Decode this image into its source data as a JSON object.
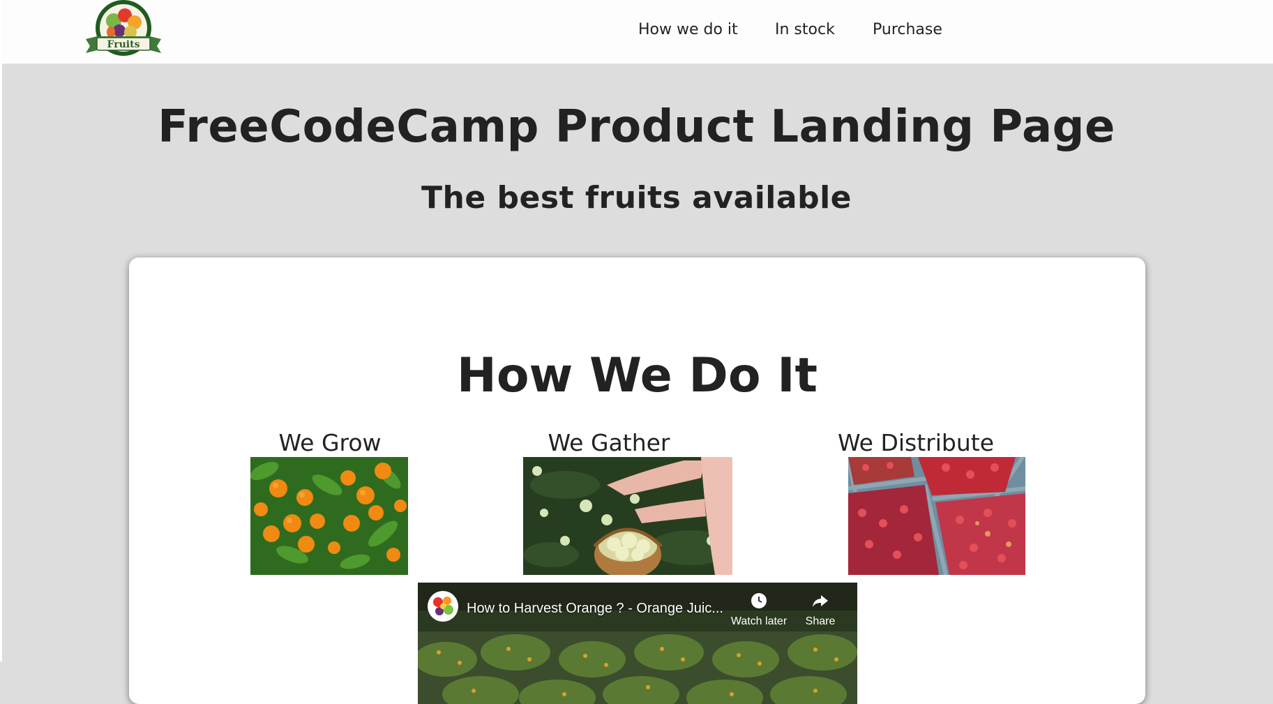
{
  "header": {
    "logo_text": "Fruits",
    "nav": [
      "How we do it",
      "In stock",
      "Purchase"
    ]
  },
  "hero": {
    "title": "FreeCodeCamp Product Landing Page",
    "subtitle": "The best fruits available"
  },
  "how": {
    "title": "How We Do It",
    "columns": [
      {
        "title": "We Grow",
        "image": "orange-tree-photo"
      },
      {
        "title": "We Gather",
        "image": "apple-gathering-photo"
      },
      {
        "title": "We Distribute",
        "image": "apple-crates-photo"
      }
    ]
  },
  "video": {
    "title": "How to Harvest Orange ? - Orange Juic...",
    "watch_later": "Watch later",
    "share": "Share"
  },
  "colors": {
    "page_bg": "#dddddd",
    "header_bg": "#fdfdfd",
    "card_bg": "#ffffff",
    "text": "#222222"
  }
}
